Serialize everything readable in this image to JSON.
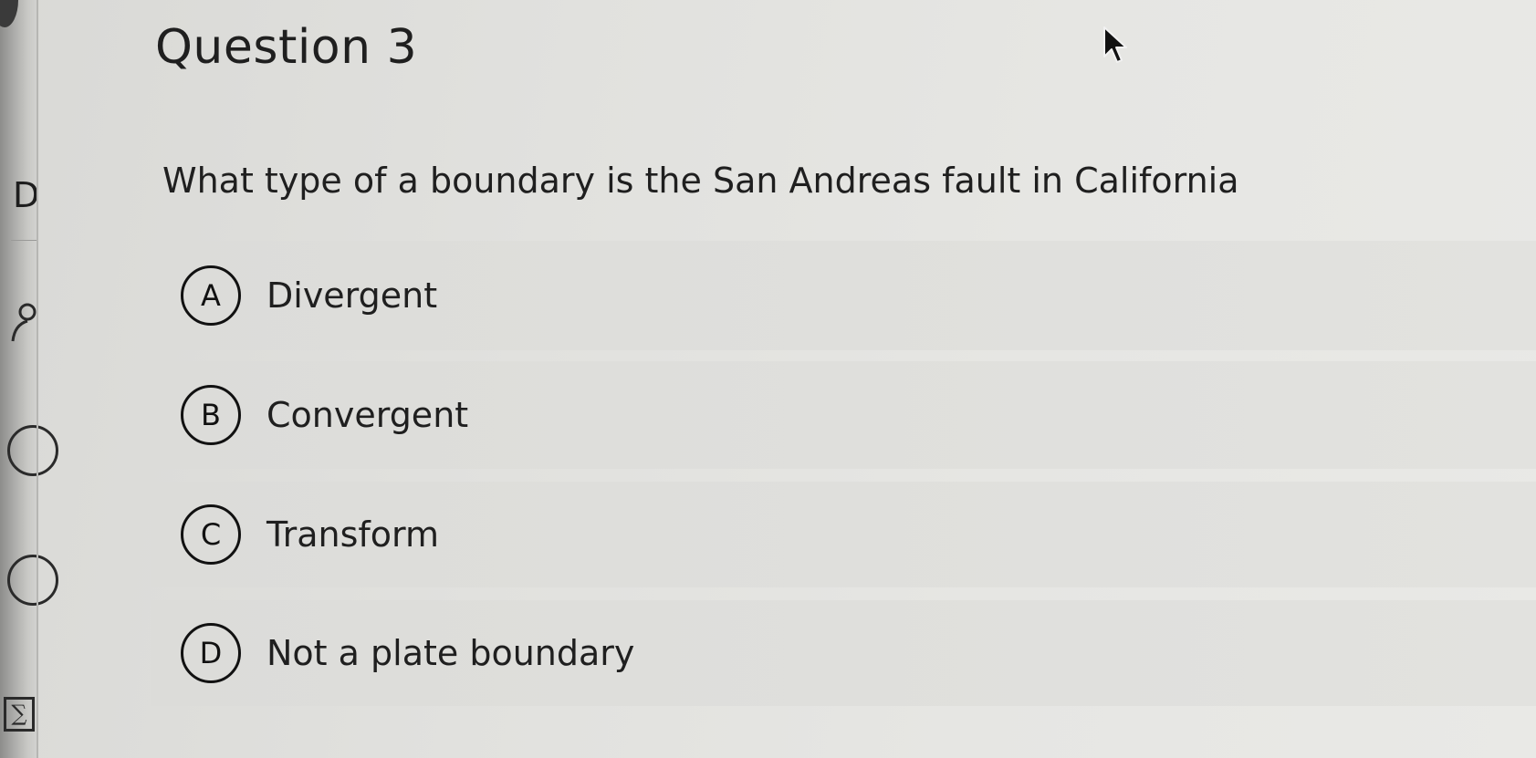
{
  "sidebar": {
    "letter": "D",
    "sigma": "∑"
  },
  "question": {
    "title": "Question 3",
    "text": "What type of a boundary is the San Andreas fault in California"
  },
  "options": [
    {
      "letter": "A",
      "label": "Divergent"
    },
    {
      "letter": "B",
      "label": "Convergent"
    },
    {
      "letter": "C",
      "label": "Transform"
    },
    {
      "letter": "D",
      "label": "Not a plate boundary"
    }
  ],
  "icons": {
    "cursor": "mouse-pointer-icon",
    "rail_person": "person-icon",
    "rail_circle_1": "circle-icon",
    "rail_circle_2": "circle-icon",
    "rail_sigma": "sigma-icon"
  }
}
